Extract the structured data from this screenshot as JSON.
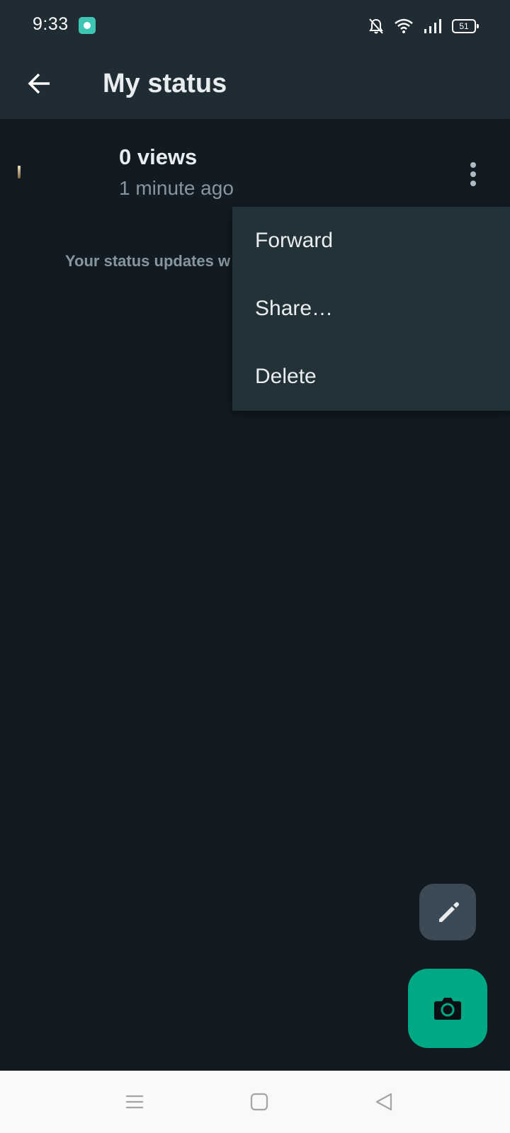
{
  "status_bar": {
    "time": "9:33",
    "battery": "51",
    "icons": [
      "app-notification-icon",
      "bell-off-icon",
      "wifi-icon",
      "signal-icon",
      "battery-icon"
    ]
  },
  "app_bar": {
    "title": "My status",
    "back_icon": "arrow-left-icon"
  },
  "status_item": {
    "views": "0 views",
    "time_ago": "1 minute ago",
    "more_icon": "more-vertical-icon"
  },
  "hint_text": "Your status updates w",
  "menu": {
    "items": [
      {
        "label": "Forward"
      },
      {
        "label": "Share…"
      },
      {
        "label": "Delete"
      }
    ]
  },
  "fabs": {
    "pencil_icon": "pencil-icon",
    "camera_icon": "camera-icon"
  },
  "nav_bar": {
    "icons": [
      "menu-icon",
      "home-icon",
      "back-icon"
    ]
  },
  "colors": {
    "background": "#121b22",
    "header": "#202c33",
    "menu": "#233138",
    "accent": "#00a884",
    "primary_text": "#e9edef",
    "secondary_text": "#8696a0"
  }
}
